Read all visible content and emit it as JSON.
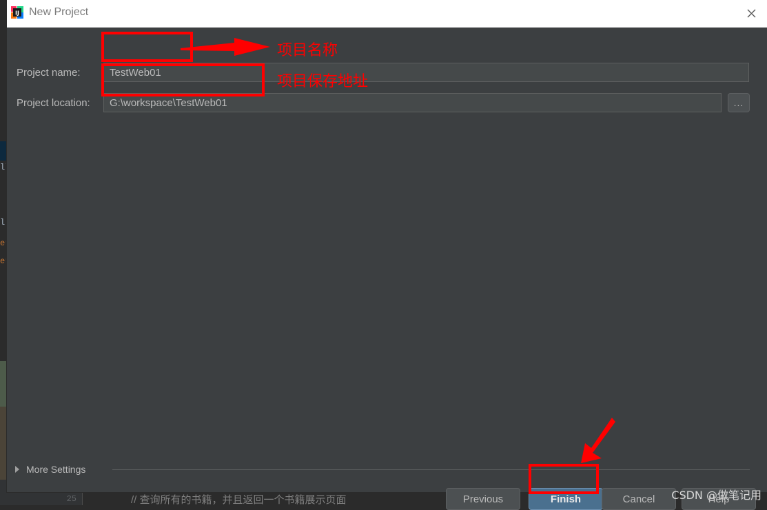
{
  "window": {
    "title": "New Project",
    "app_icon": "intellij-idea-icon",
    "close_icon": "close-icon"
  },
  "form": {
    "name_label": "Project name:",
    "name_value": "TestWeb01",
    "location_label": "Project location:",
    "location_value": "G:\\workspace\\TestWeb01",
    "browse_label": "...",
    "browse_icon": "ellipsis-icon"
  },
  "more_settings": {
    "label": "More Settings",
    "expander_icon": "chevron-right-icon"
  },
  "buttons": {
    "previous": "Previous",
    "finish": "Finish",
    "cancel": "Cancel",
    "help": "Help"
  },
  "annotations": {
    "name_note": "项目名称",
    "location_note": "项目保存地址",
    "color": "#ff0000"
  },
  "watermark": {
    "text": "CSDN @做笔记用"
  },
  "background": {
    "editor_comment": "// 查询所有的书籍，并且返回一个书籍展示页面",
    "gutter_line": "25",
    "code_fragments": [
      "ll",
      "l",
      "er",
      "er"
    ]
  },
  "colors": {
    "dialog_bg": "#3c3f41",
    "field_bg": "#45494a",
    "accent": "#4a708f",
    "text": "#bbbbbb",
    "titlebar_bg": "#ffffff"
  }
}
